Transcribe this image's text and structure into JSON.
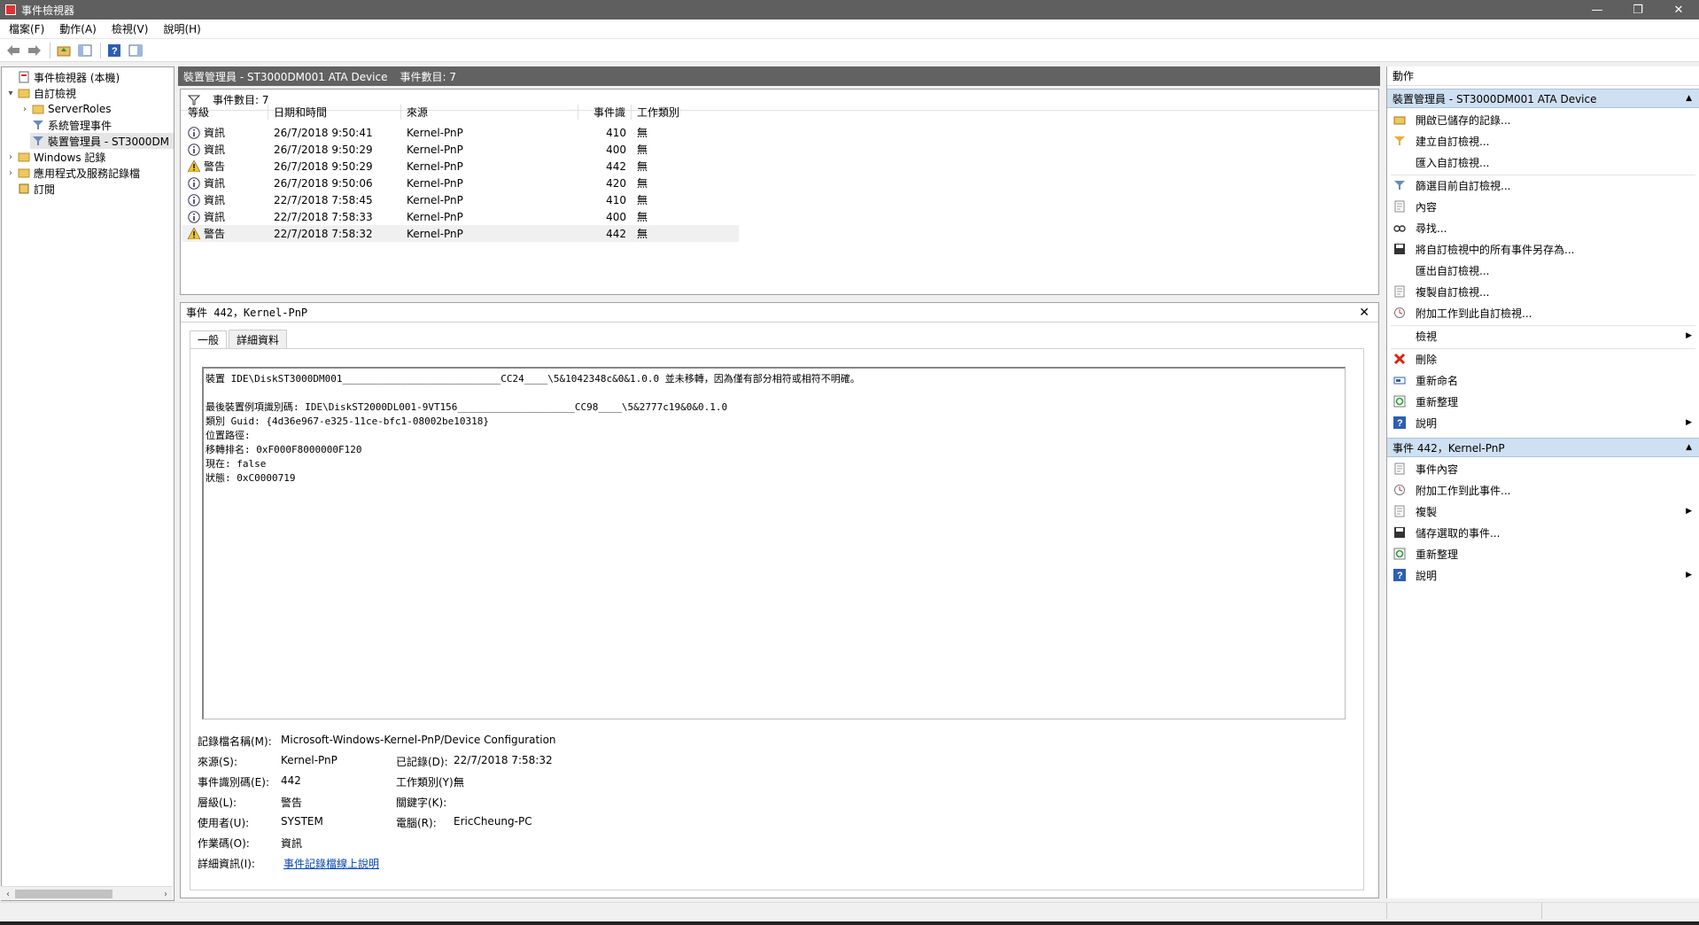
{
  "window": {
    "title": "事件檢視器",
    "minimize": "—",
    "restore": "❐",
    "close": "✕"
  },
  "menu": [
    "檔案(F)",
    "動作(A)",
    "檢視(V)",
    "說明(H)"
  ],
  "tree": {
    "root": "事件檢視器 (本機)",
    "custom_views": "自訂檢視",
    "server_roles": "ServerRoles",
    "admin_events": "系統管理事件",
    "device_mgr": "裝置管理員 - ST3000DM",
    "windows_logs": "Windows 記錄",
    "app_logs": "應用程式及服務記錄檔",
    "subscriptions": "訂閱"
  },
  "center": {
    "header_title": "裝置管理員 - ST3000DM001 ATA Device",
    "header_count": "事件數目: 7",
    "filter_count": "事件數目: 7",
    "columns": {
      "level": "等級",
      "date": "日期和時間",
      "source": "來源",
      "id": "事件識",
      "category": "工作類別"
    },
    "rows": [
      {
        "level": "資訊",
        "type": "info",
        "date": "26/7/2018 9:50:41",
        "source": "Kernel-PnP",
        "id": "410",
        "category": "無"
      },
      {
        "level": "資訊",
        "type": "info",
        "date": "26/7/2018 9:50:29",
        "source": "Kernel-PnP",
        "id": "400",
        "category": "無"
      },
      {
        "level": "警告",
        "type": "warn",
        "date": "26/7/2018 9:50:29",
        "source": "Kernel-PnP",
        "id": "442",
        "category": "無"
      },
      {
        "level": "資訊",
        "type": "info",
        "date": "26/7/2018 9:50:06",
        "source": "Kernel-PnP",
        "id": "420",
        "category": "無"
      },
      {
        "level": "資訊",
        "type": "info",
        "date": "22/7/2018 7:58:45",
        "source": "Kernel-PnP",
        "id": "410",
        "category": "無"
      },
      {
        "level": "資訊",
        "type": "info",
        "date": "22/7/2018 7:58:33",
        "source": "Kernel-PnP",
        "id": "400",
        "category": "無"
      },
      {
        "level": "警告",
        "type": "warn",
        "date": "22/7/2018 7:58:32",
        "source": "Kernel-PnP",
        "id": "442",
        "category": "無"
      }
    ]
  },
  "detail": {
    "title": "事件 442，Kernel-PnP",
    "tab_general": "一般",
    "tab_details": "詳細資料",
    "desc_lines": [
      "裝置 IDE\\DiskST3000DM001___________________________CC24____\\5&1042348c&0&1.0.0 並未移轉，因為僅有部分相符或相符不明確。",
      "",
      "最後裝置例項識別碼: IDE\\DiskST2000DL001-9VT156____________________CC98____\\5&2777c19&0&0.1.0",
      "類別 Guid: {4d36e967-e325-11ce-bfc1-08002be10318}",
      "位置路徑:",
      "移轉排名: 0xF000F8000000F120",
      "現在: false",
      "狀態: 0xC0000719"
    ],
    "log_name_label": "記錄檔名稱(M):",
    "log_name": "Microsoft-Windows-Kernel-PnP/Device Configuration",
    "source_label": "來源(S):",
    "source": "Kernel-PnP",
    "logged_label": "已記錄(D):",
    "logged": "22/7/2018 7:58:32",
    "event_id_label": "事件識別碼(E):",
    "event_id": "442",
    "task_label": "工作類別(Y):",
    "task": "無",
    "level_label": "層級(L):",
    "level": "警告",
    "keywords_label": "關鍵字(K):",
    "user_label": "使用者(U):",
    "user": "SYSTEM",
    "computer_label": "電腦(R):",
    "computer": "EricCheung-PC",
    "opcode_label": "作業碼(O):",
    "opcode": "資訊",
    "more_info_label": "詳細資訊(I):",
    "more_info_link": "事件記錄檔線上說明"
  },
  "actions": {
    "title": "動作",
    "section1": "裝置管理員 - ST3000DM001 ATA Device",
    "items1": [
      "開啟已儲存的記錄...",
      "建立自訂檢視...",
      "匯入自訂檢視...",
      "篩選目前自訂檢視...",
      "內容",
      "尋找...",
      "將自訂檢視中的所有事件另存為...",
      "匯出自訂檢視...",
      "複製自訂檢視...",
      "附加工作到此自訂檢視...",
      "檢視",
      "刪除",
      "重新命名",
      "重新整理",
      "說明"
    ],
    "section2": "事件 442，Kernel-PnP",
    "items2": [
      "事件內容",
      "附加工作到此事件...",
      "複製",
      "儲存選取的事件...",
      "重新整理",
      "說明"
    ]
  },
  "colors": {
    "accent_header": "#626262",
    "section_bg": "#cfe0f2",
    "link": "#0645ad"
  }
}
